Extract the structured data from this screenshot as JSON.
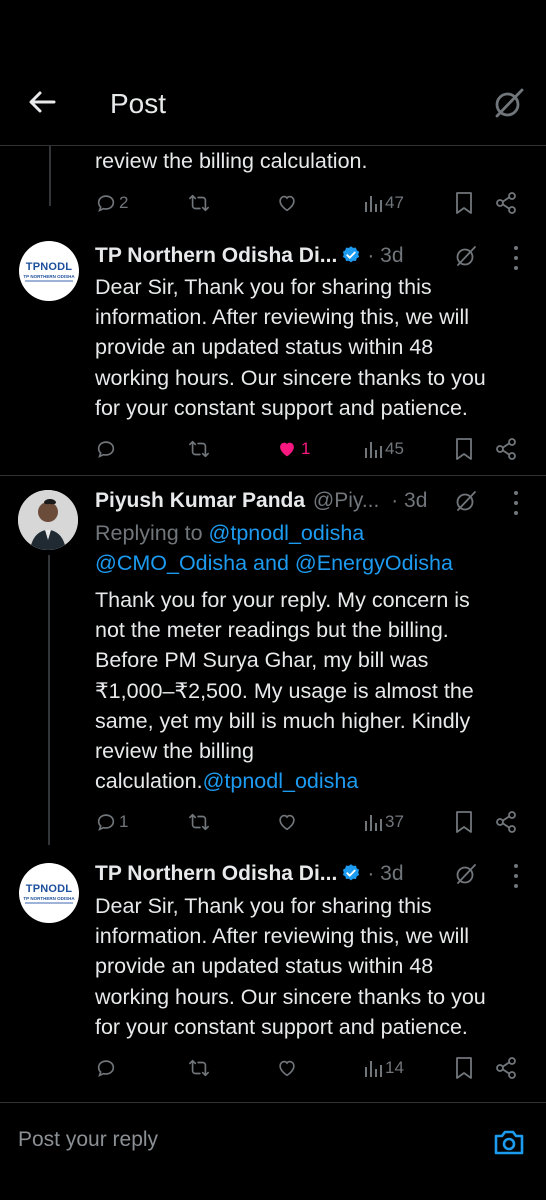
{
  "header": {
    "title": "Post"
  },
  "top_fragment": {
    "text": "review the billing calculation.",
    "actions": {
      "replies": "2",
      "reposts": "",
      "likes": "",
      "views": "47"
    }
  },
  "posts": [
    {
      "name": "TP Northern Odisha Di...",
      "meta": "· 3d",
      "avatar_text": "TPNODL",
      "avatar_sub": "TP NORTHERN ODISHA",
      "text_lines": [
        "Dear Sir, Thank you for sharing this",
        "information. After reviewing this, we will",
        "provide an updated status within 48",
        "working hours. Our sincere thanks to you",
        "for your constant support and patience."
      ],
      "actions": {
        "replies": "",
        "reposts": "",
        "likes": "1",
        "views": "45"
      }
    },
    {
      "name": "Piyush Kumar Panda",
      "handle": "@Piy...",
      "meta": "· 3d",
      "replying_label": "Replying to ",
      "replying_line1_handle": "@tpnodl_odisha",
      "replying_line2": [
        "@CMO_Odisha",
        " and ",
        "@EnergyOdisha"
      ],
      "text_lines": [
        "Thank you for your reply. My concern is",
        "not the meter readings but the billing.",
        "Before PM Surya Ghar, my bill was",
        "₹1,000–₹2,500. My usage is almost the",
        "same, yet my bill is much higher. Kindly",
        "review the billing"
      ],
      "last_line_text": "calculation.",
      "last_line_mention": "@tpnodl_odisha",
      "actions": {
        "replies": "1",
        "reposts": "",
        "likes": "",
        "views": "37"
      }
    },
    {
      "name": "TP Northern Odisha Di...",
      "meta": "· 3d",
      "avatar_text": "TPNODL",
      "avatar_sub": "TP NORTHERN ODISHA",
      "text_lines": [
        "Dear Sir, Thank you for sharing this",
        "information. After reviewing this, we will",
        "provide an updated status within 48",
        "working hours. Our sincere thanks to you",
        "for your constant support and patience."
      ],
      "actions": {
        "replies": "",
        "reposts": "",
        "likes": "",
        "views": "14"
      }
    }
  ],
  "reply_bar": {
    "placeholder": "Post your reply"
  },
  "colors": {
    "background": "#000000",
    "text": "#e7e9ea",
    "muted": "#71767b",
    "link": "#1d9bf0",
    "like": "#f91880",
    "divider": "#2f3336"
  },
  "icons": [
    "back-arrow-icon",
    "grok-icon",
    "reply-icon",
    "repost-icon",
    "like-icon",
    "views-icon",
    "bookmark-icon",
    "share-icon",
    "verified-icon",
    "more-icon",
    "camera-icon"
  ]
}
